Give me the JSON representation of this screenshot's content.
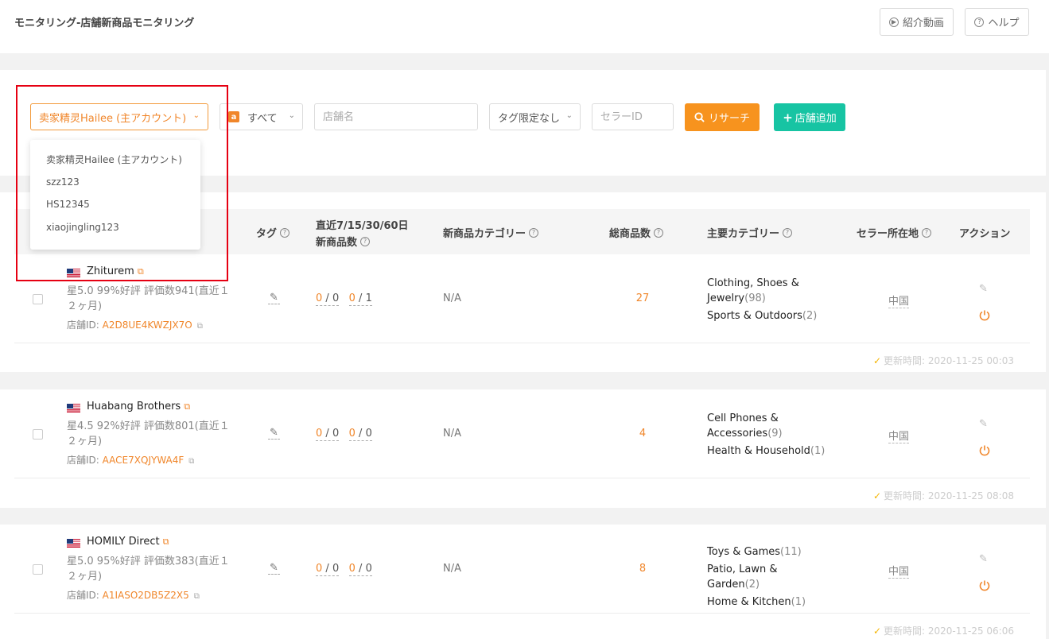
{
  "header": {
    "title": "モニタリング-店舗新商品モニタリング",
    "intro_video_label": "紹介動画",
    "help_label": "ヘルプ"
  },
  "filters": {
    "account_selected": "卖家精灵Hailee (主アカウント)",
    "marketplace_label": "すべて",
    "marketplace_icon": "amazon-icon",
    "store_name_placeholder": "店舗名",
    "tag_filter_label": "タグ限定なし",
    "seller_id_placeholder": "セラーID",
    "research_label": "リサーチ",
    "add_store_label": "店舗追加"
  },
  "account_dropdown": {
    "options": [
      "卖家精灵Hailee (主アカウント)",
      "szz123",
      "HS12345",
      "xiaojingling123"
    ]
  },
  "table": {
    "headers": {
      "tag": "タグ",
      "recent_new_line1": "直近7/15/30/60日",
      "recent_new_line2": "新商品数",
      "new_category": "新商品カテゴリー",
      "total_products": "総商品数",
      "main_category": "主要カテゴリー",
      "seller_location": "セラー所在地",
      "action": "アクション"
    },
    "rows": [
      {
        "name": "Zhiturem",
        "rating_text": "星5.0  99%好評  評価数941(直近１２ヶ月)",
        "store_id_label": "店舗ID: ",
        "store_id": "A2D8UE4KWZJX7O",
        "n7": "0",
        "n15": "0",
        "n30": "0",
        "n60": "1",
        "new_category": "N/A",
        "total": "27",
        "cat1_name": "Clothing, Shoes & Jewelry",
        "cat1_count": "(98)",
        "cat2_name": "Sports & Outdoors",
        "cat2_count": "(2)",
        "cat3_name": "",
        "cat3_count": "",
        "location": "中国",
        "updated": "更新時間: 2020-11-25 00:03"
      },
      {
        "name": "Huabang Brothers",
        "rating_text": "星4.5  92%好評  評価数801(直近１２ヶ月)",
        "store_id_label": "店舗ID: ",
        "store_id": "AACE7XQJYWA4F",
        "n7": "0",
        "n15": "0",
        "n30": "0",
        "n60": "0",
        "new_category": "N/A",
        "total": "4",
        "cat1_name": "Cell Phones & Accessories",
        "cat1_count": "(9)",
        "cat2_name": "Health & Household",
        "cat2_count": "(1)",
        "cat3_name": "",
        "cat3_count": "",
        "location": "中国",
        "updated": "更新時間: 2020-11-25 08:08"
      },
      {
        "name": "HOMILY Direct",
        "rating_text": "星5.0  95%好評  評価数383(直近１２ヶ月)",
        "store_id_label": "店舗ID: ",
        "store_id": "A1IASO2DB5Z2X5",
        "n7": "0",
        "n15": "0",
        "n30": "0",
        "n60": "0",
        "new_category": "N/A",
        "total": "8",
        "cat1_name": "Toys & Games",
        "cat1_count": "(11)",
        "cat2_name": "Patio, Lawn & Garden",
        "cat2_count": "(2)",
        "cat3_name": "Home & Kitchen",
        "cat3_count": "(1)",
        "location": "中国",
        "updated": "更新時間: 2020-11-25 06:06"
      }
    ]
  },
  "colors": {
    "accent_orange": "#f7931e",
    "accent_teal": "#17c4a3",
    "highlight_red": "#e60012"
  }
}
